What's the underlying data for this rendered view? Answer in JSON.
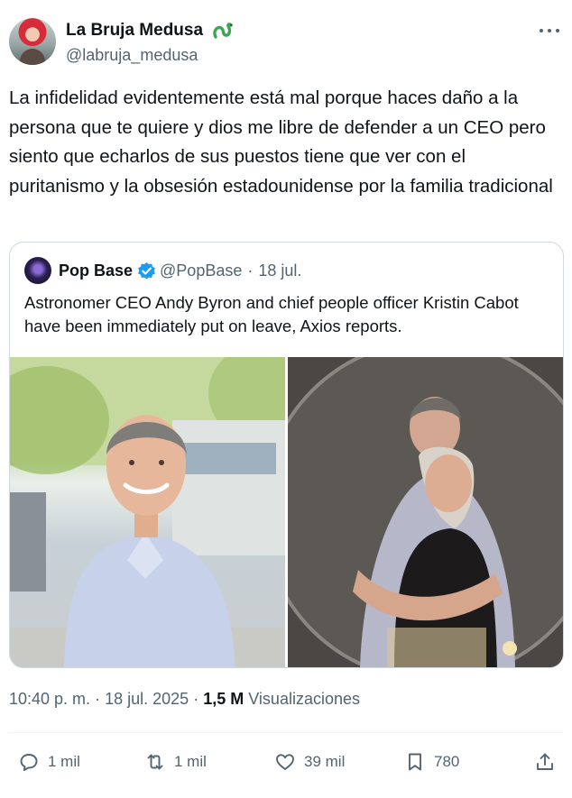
{
  "author": {
    "display_name": "La Bruja Medusa",
    "handle": "@labruja_medusa",
    "badge_icon": "snake-icon"
  },
  "tweet": {
    "text": "La infidelidad evidentemente está mal porque haces daño a la persona que te quiere y dios me libre de defender a un CEO pero siento que echarlos de sus puestos tiene que ver con el puritanismo y la obsesión estadounidense por la familia tradicional"
  },
  "quote": {
    "display_name": "Pop Base",
    "handle": "@PopBase",
    "separator": "·",
    "date": "18 jul.",
    "text": "Astronomer CEO Andy Byron and chief people officer Kristin Cabot have been immediately put on leave, Axios reports.",
    "verified_color": "#1d9bf0"
  },
  "meta": {
    "time": "10:40 p. m.",
    "separator": "·",
    "date": "18 jul. 2025",
    "views_count": "1,5 M",
    "views_label": "Visualizaciones"
  },
  "actions": {
    "replies": "1 mil",
    "reposts": "1 mil",
    "likes": "39 mil",
    "bookmarks": "780"
  },
  "colors": {
    "text": "#0f1419",
    "secondary": "#536471",
    "border": "#cfd9de",
    "accent": "#1d9bf0"
  }
}
